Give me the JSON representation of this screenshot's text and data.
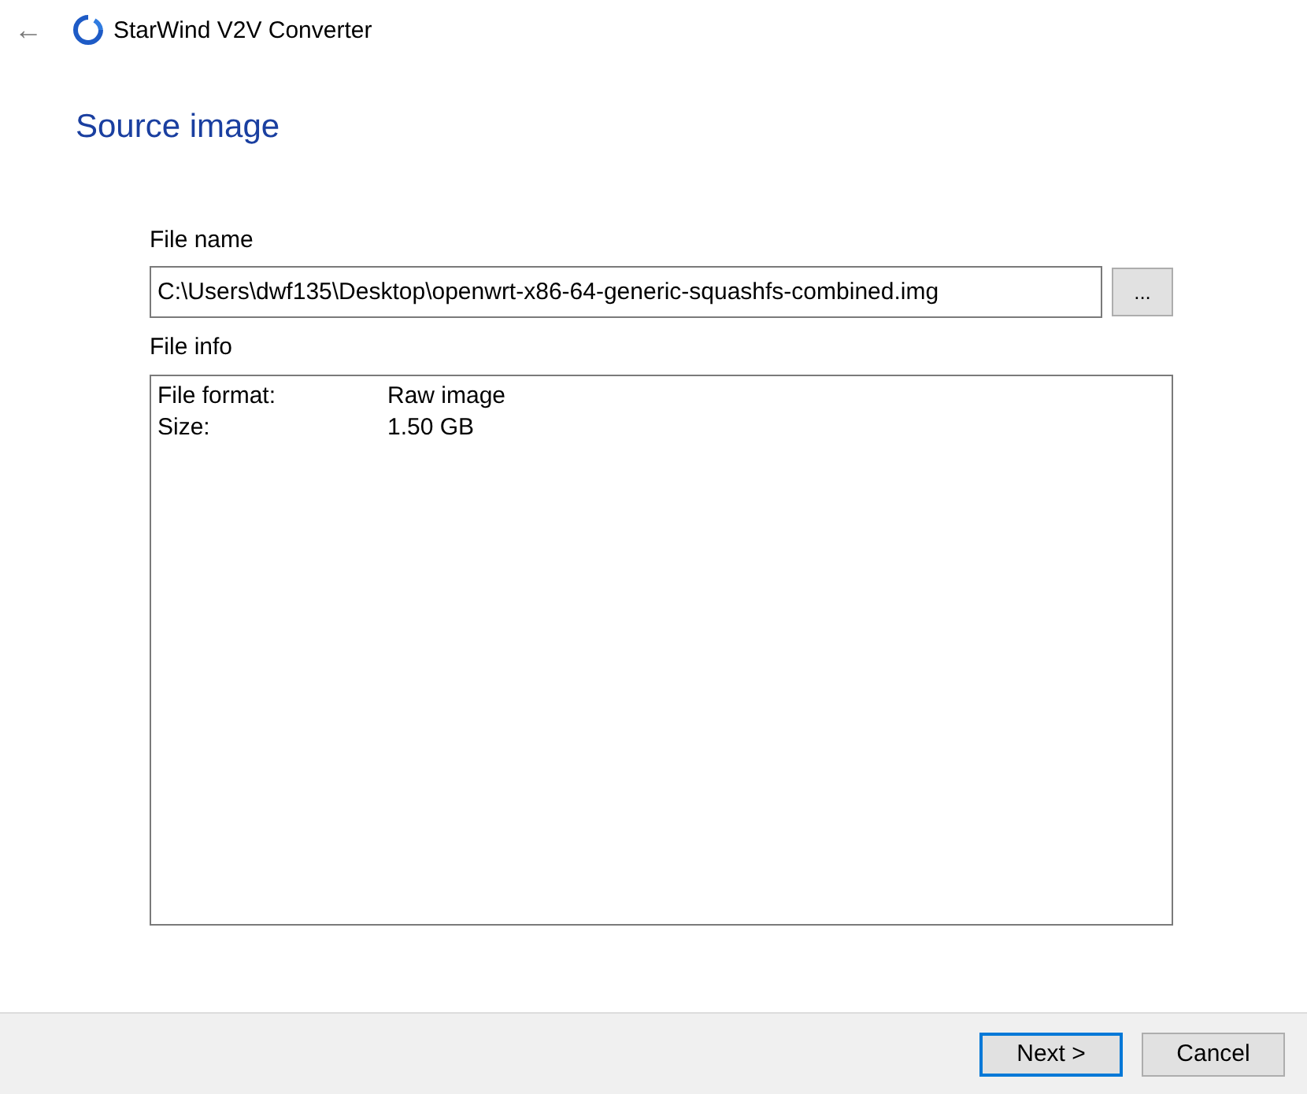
{
  "window": {
    "title": "StarWind V2V Converter",
    "back": "←"
  },
  "page": {
    "heading": "Source image"
  },
  "file_name": {
    "label": "File name",
    "value": "C:\\Users\\dwf135\\Desktop\\openwrt-x86-64-generic-squashfs-combined.img",
    "browse": "..."
  },
  "file_info": {
    "label": "File info",
    "rows": [
      {
        "name": "File format:",
        "value": "Raw image"
      },
      {
        "name": "Size:",
        "value": "1.50 GB"
      }
    ]
  },
  "buttons": [
    {
      "label": "Next >",
      "focused": true
    },
    {
      "label": "Cancel",
      "focused": false
    }
  ]
}
